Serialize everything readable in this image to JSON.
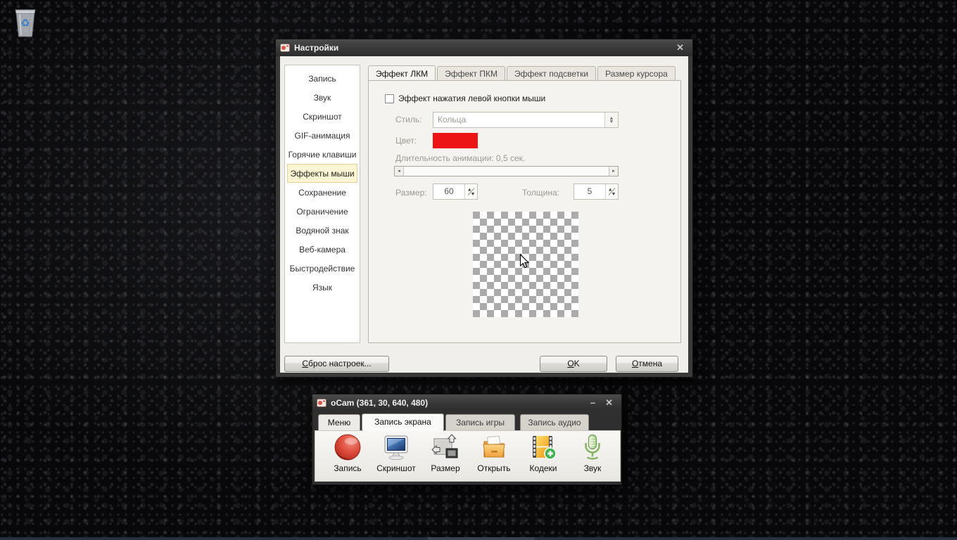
{
  "desktop": {
    "recycle_bin_icon": "recycle-bin-icon",
    "recycle_symbol": "♻"
  },
  "colors": {
    "effect_color_swatch": "#ec1414",
    "sidebar_selected_bg": "#fcf4d3",
    "desktop_bg": "#08080a"
  },
  "settings_window": {
    "title": "Настройки",
    "close_icon": "✕",
    "sidebar": {
      "items": [
        {
          "label": "Запись",
          "selected": false
        },
        {
          "label": "Звук",
          "selected": false
        },
        {
          "label": "Скриншот",
          "selected": false
        },
        {
          "label": "GIF-анимация",
          "selected": false
        },
        {
          "label": "Горячие клавиши",
          "selected": false
        },
        {
          "label": "Эффекты мыши",
          "selected": true
        },
        {
          "label": "Сохранение",
          "selected": false
        },
        {
          "label": "Ограничение",
          "selected": false
        },
        {
          "label": "Водяной знак",
          "selected": false
        },
        {
          "label": "Веб-камера",
          "selected": false
        },
        {
          "label": "Быстродействие",
          "selected": false
        },
        {
          "label": "Язык",
          "selected": false
        }
      ]
    },
    "tabs": [
      {
        "label": "Эффект ЛКМ",
        "active": true
      },
      {
        "label": "Эффект ПКМ",
        "active": false
      },
      {
        "label": "Эффект подсветки",
        "active": false
      },
      {
        "label": "Размер курсора",
        "active": false
      }
    ],
    "panel": {
      "checkbox_label": "Эффект нажатия левой кнопки мыши",
      "checkbox_checked": false,
      "style_label": "Стиль:",
      "style_value": "Кольца",
      "color_label": "Цвет:",
      "color_value": "#ec1414",
      "duration_label": "Длительность анимации: 0,5 сек.",
      "slider_left_arrow": "◂",
      "slider_right_arrow": "▸",
      "combo_up_arrow": "▲",
      "combo_down_arrow": "▼",
      "size_label": "Размер:",
      "size_value": "60",
      "thickness_label": "Толщина:",
      "thickness_value": "5"
    },
    "buttons": {
      "reset_accel": "С",
      "reset_rest": "брос настроек...",
      "ok_accel": "O",
      "ok_rest": "K",
      "cancel_accel": "О",
      "cancel_rest": "тмена"
    }
  },
  "ocam_window": {
    "title": "oCam (361, 30, 640, 480)",
    "minimize_icon": "–",
    "close_icon": "✕",
    "tabs": [
      {
        "label": "Меню",
        "active": false
      },
      {
        "label": "Запись экрана",
        "active": true
      },
      {
        "label": "Запись игры",
        "active": false
      },
      {
        "label": "Запись аудио",
        "active": false
      }
    ],
    "toolbar": [
      {
        "icon": "record-icon",
        "label": "Запись"
      },
      {
        "icon": "screenshot-icon",
        "label": "Скриншот"
      },
      {
        "icon": "resize-icon",
        "label": "Размер"
      },
      {
        "icon": "open-icon",
        "label": "Открыть"
      },
      {
        "icon": "codecs-icon",
        "label": "Кодеки"
      },
      {
        "icon": "sound-icon",
        "label": "Звук"
      }
    ]
  }
}
